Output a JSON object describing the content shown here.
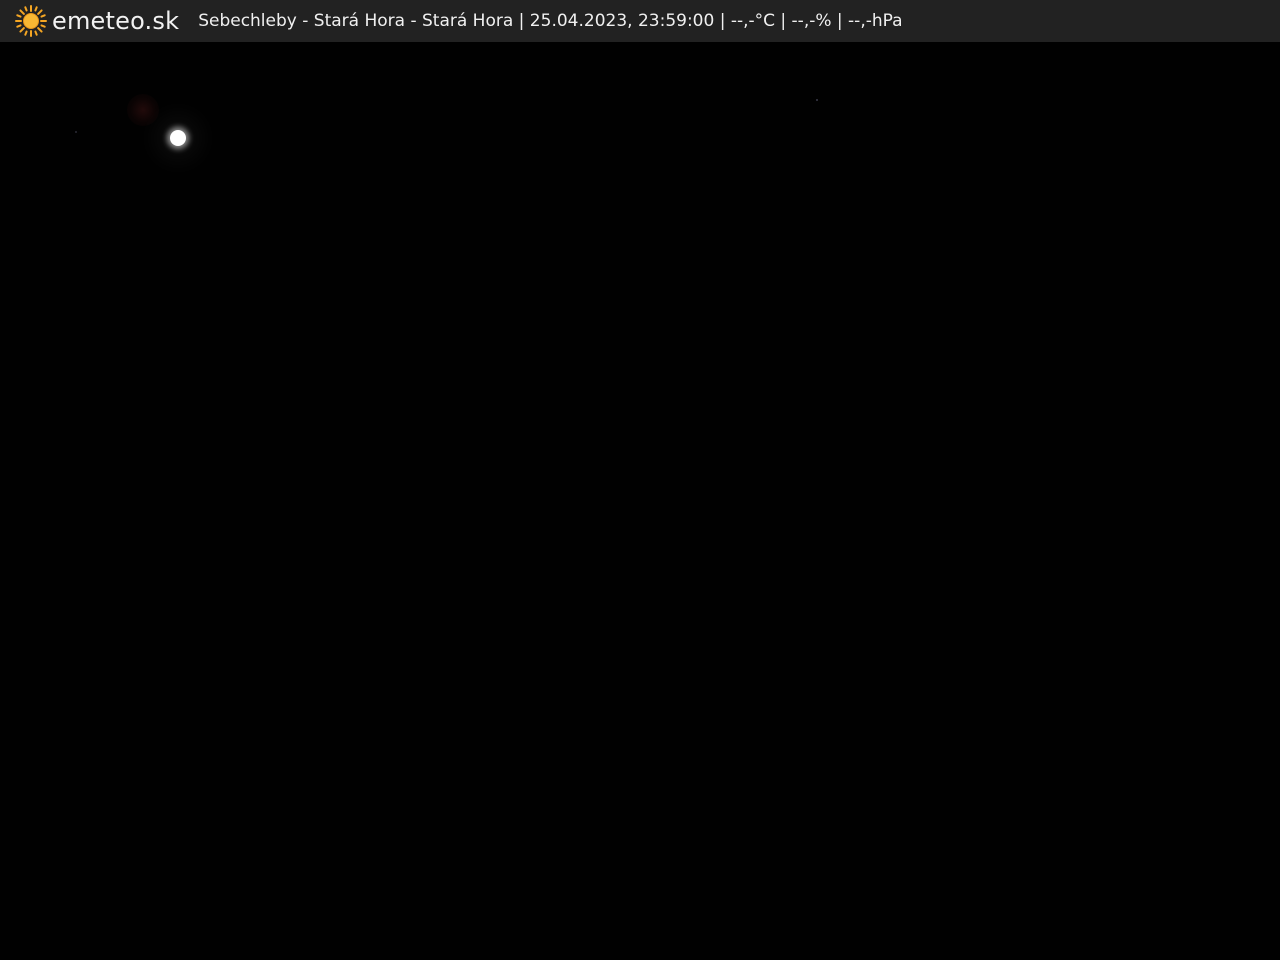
{
  "header": {
    "brand": "emeteo.sk",
    "caption": "Sebechleby - Stará Hora - Stará Hora | 25.04.2023, 23:59:00 | --,-°C | --,-% | --,-hPa",
    "logo_icon": "sun-icon",
    "logo_color": "#f5a623",
    "bar_color": "#222222"
  },
  "scene": {
    "background_color": "#010101",
    "moon_color": "#ffffff"
  }
}
